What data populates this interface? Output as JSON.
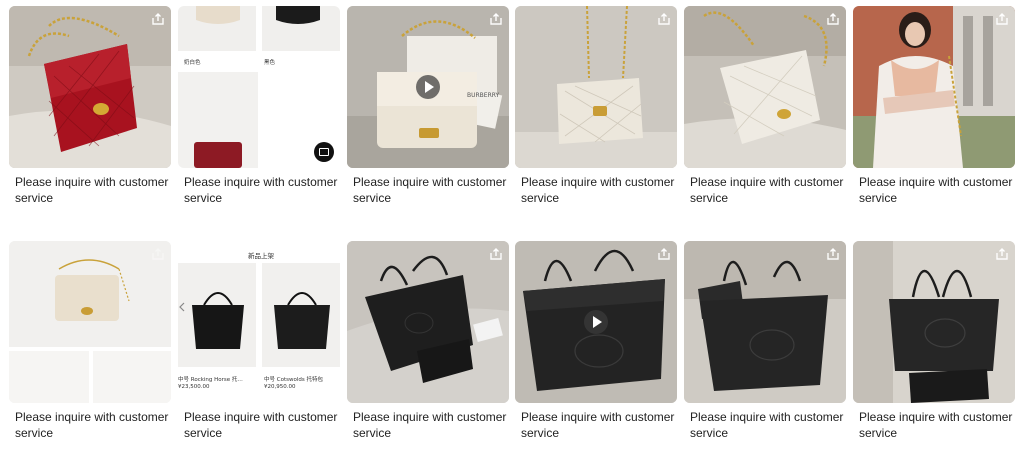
{
  "products": [
    {
      "caption": "Please inquire with customer service",
      "media": "photo"
    },
    {
      "caption": "Please inquire with customer service",
      "media": "photo",
      "swatch_labels": [
        "奶白色",
        "黑色"
      ]
    },
    {
      "caption": "Please inquire with customer service",
      "media": "video",
      "bag_text": "BURBERRY"
    },
    {
      "caption": "Please inquire with customer service",
      "media": "photo"
    },
    {
      "caption": "Please inquire with customer service",
      "media": "photo"
    },
    {
      "caption": "Please inquire with customer service",
      "media": "photo"
    },
    {
      "caption": "Please inquire with customer service",
      "media": "photo"
    },
    {
      "caption": "Please inquire with customer service",
      "media": "photo",
      "header_text": "新品上架",
      "listing": [
        {
          "name": "中号 Rocking Horse 托…",
          "price": "¥23,500.00"
        },
        {
          "name": "中号 Cotswolds 托特包",
          "price": "¥20,950.00"
        }
      ]
    },
    {
      "caption": "Please inquire with customer service",
      "media": "photo"
    },
    {
      "caption": "Please inquire with customer service",
      "media": "video"
    },
    {
      "caption": "Please inquire with customer service",
      "media": "photo"
    },
    {
      "caption": "Please inquire with customer service",
      "media": "photo"
    }
  ],
  "icons": {
    "share": "share-icon",
    "play": "play-icon",
    "image": "image-icon",
    "prev": "chevron-left-icon"
  }
}
